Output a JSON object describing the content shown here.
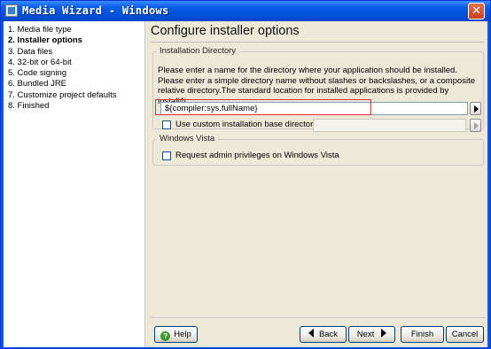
{
  "window": {
    "title": "Media Wizard - Windows",
    "close_glyph": "✕"
  },
  "steps": [
    {
      "label": "1. Media file type",
      "active": false
    },
    {
      "label": "2. Installer options",
      "active": true
    },
    {
      "label": "3. Data files",
      "active": false
    },
    {
      "label": "4. 32-bit or 64-bit",
      "active": false
    },
    {
      "label": "5. Code signing",
      "active": false
    },
    {
      "label": "6. Bundled JRE",
      "active": false
    },
    {
      "label": "7. Customize project defaults",
      "active": false
    },
    {
      "label": "8. Finished",
      "active": false
    }
  ],
  "main": {
    "heading": "Configure installer options",
    "installation_directory": {
      "label": "Installation Directory",
      "description": "Please enter a name for the directory where your application should be installed. Please enter a simple directory name without slashes or backslashes, or a composite relative directory.The standard location for installed applications is provided by install4j.",
      "directory_value": "${compiler:sys.fullName}",
      "use_custom_base_label": "Use custom installation base directory:",
      "use_custom_base_checked": false,
      "custom_base_value": ""
    },
    "windows_vista": {
      "label": "Windows Vista",
      "admin_privileges_label": "Request admin privileges on Windows Vista",
      "admin_privileges_checked": false
    }
  },
  "buttons": {
    "help": "Help",
    "back": "Back",
    "next": "Next",
    "finish": "Finish",
    "cancel": "Cancel"
  },
  "colors": {
    "titlebar": "#0a5fe8",
    "highlight_outline": "#e03030",
    "dialog_background": "#ece9d8"
  }
}
